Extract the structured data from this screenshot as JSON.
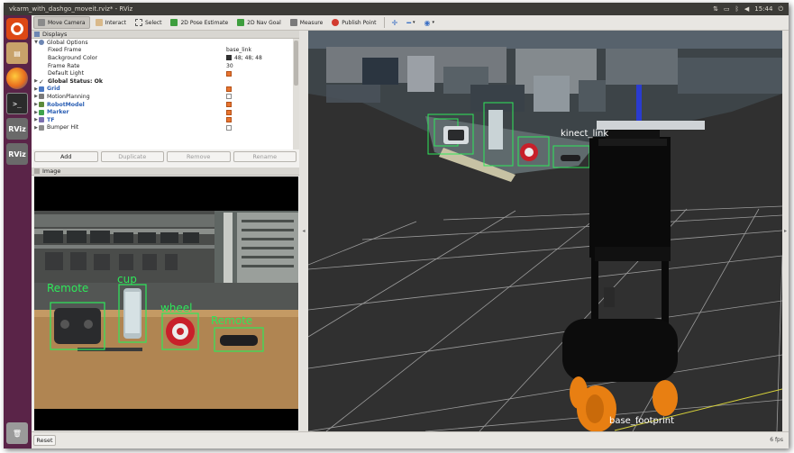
{
  "window": {
    "title": "vkarm_with_dashgo_moveit.rviz* - RViz",
    "clock": "15:44",
    "tray_icons": [
      "network-icon",
      "keyboard-icon",
      "bluetooth-icon",
      "volume-icon",
      "power-icon"
    ]
  },
  "launcher": {
    "items": [
      "ubuntu-dash",
      "files",
      "firefox",
      "terminal",
      "rviz",
      "rviz",
      "trash"
    ],
    "rviz_label": "RViz",
    "terminal_label": ">_"
  },
  "toolbar": {
    "move_camera": "Move Camera",
    "interact": "Interact",
    "select": "Select",
    "pose_estimate": "2D Pose Estimate",
    "nav_goal": "2D Nav Goal",
    "measure": "Measure",
    "publish_point": "Publish Point"
  },
  "displays_panel": {
    "title": "Displays",
    "global_options": "Global Options",
    "fixed_frame_label": "Fixed Frame",
    "fixed_frame_value": "base_link",
    "background_color_label": "Background Color",
    "background_color_value": "48; 48; 48",
    "background_color_hex": "#303030",
    "frame_rate_label": "Frame Rate",
    "frame_rate_value": "30",
    "default_light_label": "Default Light",
    "global_status": "Global Status: Ok",
    "items": [
      {
        "label": "Grid",
        "checked": true,
        "color": "#4a78c4"
      },
      {
        "label": "MotionPlanning",
        "checked": false,
        "color": "#7a7a7a"
      },
      {
        "label": "RobotModel",
        "checked": true,
        "color": "#5c8a3a"
      },
      {
        "label": "Marker",
        "checked": true,
        "color": "#3fa34d"
      },
      {
        "label": "TF",
        "checked": true,
        "color": "#7a6fb0"
      },
      {
        "label": "Bumper Hit",
        "checked": false,
        "color": "#8c8c8c"
      }
    ],
    "buttons": {
      "add": "Add",
      "duplicate": "Duplicate",
      "remove": "Remove",
      "rename": "Rename"
    }
  },
  "image_panel": {
    "title": "Image",
    "detections": [
      "Remote",
      "cup",
      "wheel",
      "Remote"
    ]
  },
  "view3d": {
    "frame_label_kinect": "kinect_link",
    "frame_label_footprint": "base_footprint",
    "markers": [
      "remote",
      "cup",
      "wheel",
      "remote"
    ]
  },
  "statusbar": {
    "reset": "Reset",
    "fps": "6 fps"
  }
}
